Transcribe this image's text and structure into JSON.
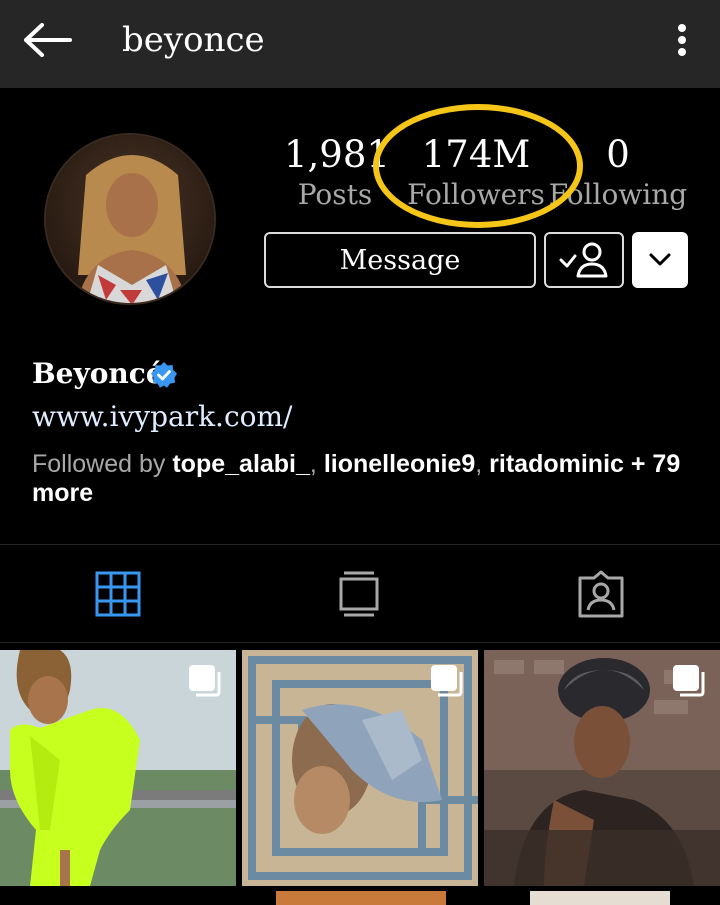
{
  "header": {
    "username": "beyonce",
    "back_icon": "arrow-left-icon",
    "more_icon": "kebab-menu-icon"
  },
  "stats": [
    {
      "value": "1,981",
      "label": "Posts"
    },
    {
      "value": "174M",
      "label": "Followers"
    },
    {
      "value": "0",
      "label": "Following"
    }
  ],
  "actions": {
    "message_label": "Message",
    "following_icon": "user-check-icon",
    "dropdown_icon": "chevron-down-icon"
  },
  "bio": {
    "name": "Beyoncé",
    "website": "www.ivypark.com/",
    "followed_by_prefix": "Followed by ",
    "followers": [
      "tope_alabi_",
      "lionelleonie9",
      "ritadominic"
    ],
    "separator": ", ",
    "more_text": " + 79 more"
  },
  "tabs": [
    {
      "name": "grid",
      "icon": "grid-icon",
      "active": true
    },
    {
      "name": "igtv",
      "icon": "igtv-icon",
      "active": false
    },
    {
      "name": "tagged",
      "icon": "tagged-icon",
      "active": false
    }
  ],
  "posts": [
    {
      "subject": "woman in neon green dress",
      "multi": true
    },
    {
      "subject": "woman lying on patterned rug",
      "multi": true
    },
    {
      "subject": "woman in head wrap in bathtub",
      "multi": true
    }
  ],
  "colors": {
    "topbar_bg": "#262626",
    "accent_blue": "#3897f0",
    "highlight_ring": "#f5c518",
    "secondary_text": "#a8a8a8"
  }
}
